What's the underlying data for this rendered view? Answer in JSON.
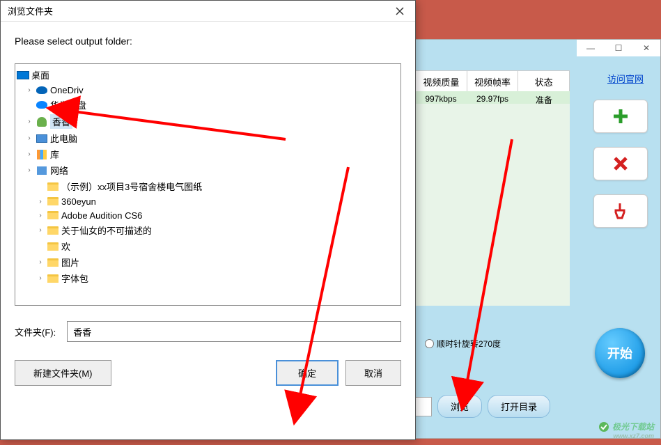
{
  "bgApp": {
    "controls": {
      "min": "—",
      "max": "☐",
      "close": "✕"
    },
    "link": "访问官网",
    "headers": [
      "视频质量",
      "视频帧率",
      "状态"
    ],
    "row": [
      "997kbps",
      "29.97fps",
      "准备"
    ],
    "radio": "顺时针旋转270度",
    "browse": "浏览",
    "openDir": "打开目录",
    "start": "开始"
  },
  "dialog": {
    "title": "浏览文件夹",
    "prompt": "Please select output folder:",
    "tree": {
      "root": "桌面",
      "items": [
        {
          "exp": "›",
          "icon": "cloud",
          "label": "OneDriv"
        },
        {
          "exp": "",
          "icon": "cloud2",
          "label": "华为云盘"
        },
        {
          "exp": "›",
          "icon": "user",
          "label": "香香",
          "sel": true
        },
        {
          "exp": "›",
          "icon": "pc",
          "label": "此电脑"
        },
        {
          "exp": "›",
          "icon": "lib",
          "label": "库"
        },
        {
          "exp": "›",
          "icon": "net",
          "label": "网络"
        },
        {
          "exp": "",
          "icon": "folder",
          "label": "（示例）xx项目3号宿舍楼电气图纸"
        },
        {
          "exp": "›",
          "icon": "folder",
          "label": "360eyun"
        },
        {
          "exp": "›",
          "icon": "folder",
          "label": "Adobe Audition CS6"
        },
        {
          "exp": "›",
          "icon": "folder",
          "label": "关于仙女的不可描述的"
        },
        {
          "exp": "",
          "icon": "folder",
          "label": "欢"
        },
        {
          "exp": "›",
          "icon": "folder",
          "label": "图片"
        },
        {
          "exp": "›",
          "icon": "folder",
          "label": "字体包"
        }
      ]
    },
    "folderLabel": "文件夹(F):",
    "folderValue": "香香",
    "newFolder": "新建文件夹(M)",
    "ok": "确定",
    "cancel": "取消"
  },
  "watermark": {
    "main": "极光下载站",
    "sub": "www.xz7.com"
  }
}
